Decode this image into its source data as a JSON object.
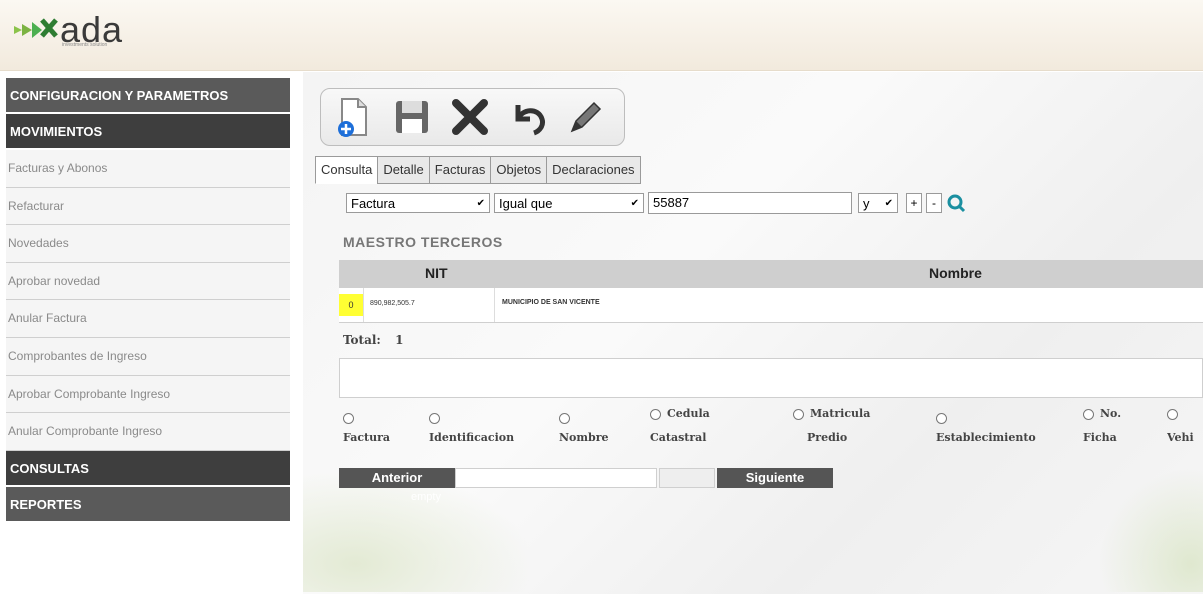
{
  "app": {
    "logo_text": "ada",
    "logo_tagline": "investments solution"
  },
  "sidebar": {
    "sections": [
      {
        "label": "CONFIGURACION Y PARAMETROS"
      },
      {
        "label": "MOVIMIENTOS"
      },
      {
        "label": "CONSULTAS"
      },
      {
        "label": "REPORTES"
      }
    ],
    "items": [
      {
        "label": "Facturas y Abonos"
      },
      {
        "label": "Refacturar"
      },
      {
        "label": "Novedades"
      },
      {
        "label": "Aprobar novedad"
      },
      {
        "label": "Anular Factura"
      },
      {
        "label": "Comprobantes de Ingreso"
      },
      {
        "label": "Aprobar Comprobante Ingreso"
      },
      {
        "label": "Anular Comprobante Ingreso"
      }
    ]
  },
  "toolbar": {
    "buttons": [
      {
        "icon": "new-document-icon"
      },
      {
        "icon": "save-icon"
      },
      {
        "icon": "delete-icon"
      },
      {
        "icon": "undo-icon"
      },
      {
        "icon": "edit-pencil-icon"
      }
    ]
  },
  "tabs": [
    {
      "label": "Consulta",
      "active": true
    },
    {
      "label": "Detalle"
    },
    {
      "label": "Facturas"
    },
    {
      "label": "Objetos"
    },
    {
      "label": "Declaraciones"
    }
  ],
  "filter": {
    "field": "Factura",
    "operator": "Igual que",
    "value": "55887",
    "logic": "y",
    "add_label": "+",
    "remove_label": "-"
  },
  "section_title": "MAESTRO TERCEROS",
  "grid": {
    "headers": {
      "nit": "NIT",
      "nombre": "Nombre"
    },
    "rows": [
      {
        "index": "0",
        "nit": "890,982,505.7",
        "nombre": "MUNICIPIO DE SAN VICENTE"
      }
    ]
  },
  "total": {
    "label": "Total:",
    "value": "1"
  },
  "search_options": [
    {
      "line1": "",
      "line2": "Factura"
    },
    {
      "line1": "",
      "line2": "Identificacion"
    },
    {
      "line1": "",
      "line2": "Nombre"
    },
    {
      "line1": "Cedula",
      "line2": "Catastral"
    },
    {
      "line1": "Matricula",
      "line2": "Predio"
    },
    {
      "line1": "",
      "line2": "Establecimiento"
    },
    {
      "line1": "No.",
      "line2": "Ficha"
    },
    {
      "line1": "",
      "line2": "Vehi"
    }
  ],
  "pager": {
    "prev_label": "Anterior",
    "next_label": "Siguiente",
    "empty_label": "empty"
  },
  "colors": {
    "sidebar_header": "#5a5a5a",
    "highlight": "#ffff33",
    "accent_search": "#1a8fa0"
  }
}
